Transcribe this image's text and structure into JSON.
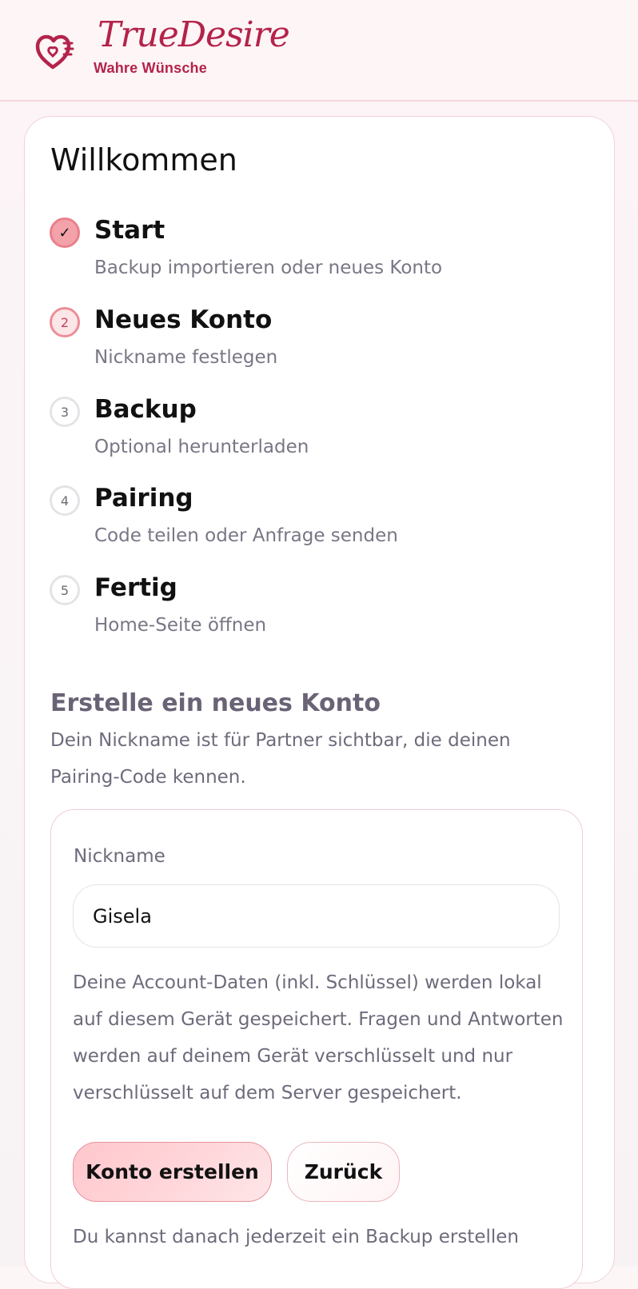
{
  "header": {
    "title": "TrueDesire",
    "subtitle": "Wahre Wünsche",
    "brand_color": "#b4234a"
  },
  "welcome_title": "Willkommen",
  "steps": [
    {
      "number": "✓",
      "title": "Start",
      "desc": "Backup importieren oder neues Konto",
      "state": "done"
    },
    {
      "number": "2",
      "title": "Neues Konto",
      "desc": "Nickname festlegen",
      "state": "active"
    },
    {
      "number": "3",
      "title": "Backup",
      "desc": "Optional herunterladen",
      "state": "pending"
    },
    {
      "number": "4",
      "title": "Pairing",
      "desc": "Code teilen oder Anfrage senden",
      "state": "pending"
    },
    {
      "number": "5",
      "title": "Fertig",
      "desc": "Home-Seite öffnen",
      "state": "pending"
    }
  ],
  "section": {
    "title": "Erstelle ein neues Konto",
    "desc": "Dein Nickname ist für Partner sichtbar, die deinen Pairing-Code kennen."
  },
  "form": {
    "nickname_label": "Nickname",
    "nickname_value": "Gisela",
    "info": "Deine Account-Daten (inkl. Schlüssel) werden lokal auf diesem Gerät gespeichert. Fragen und Antworten werden auf deinem Gerät verschlüsselt und nur verschlüsselt auf dem Server gespeichert.",
    "create_button": "Konto erstellen",
    "back_button": "Zurück",
    "footer": "Du kannst danach jederzeit ein Backup erstellen"
  }
}
